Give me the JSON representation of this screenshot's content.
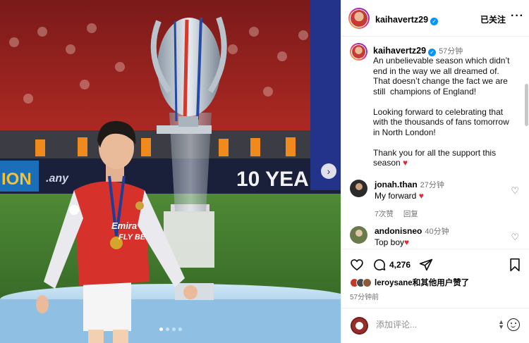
{
  "post": {
    "photo_alt": "Player walking past trophy on pitch",
    "carousel": {
      "total": 4,
      "active": 0
    },
    "stadium_board_text": "10 YEA"
  },
  "header": {
    "username": "kaihavertz29",
    "follow_state": "已关注",
    "more_label": "···"
  },
  "caption": {
    "username": "kaihavertz29",
    "time": "57分钟",
    "text": "An unbelievable season which didn’t end in the way we all dreamed of. That doesn’t change the fact we are still  champions of England!\n\nLooking forward to celebrating that with the thousands of fans tomorrow in North London!\n\nThank you for all the support this season ",
    "heart": "♥"
  },
  "comments": [
    {
      "username": "jonah.than",
      "time": "27分钟",
      "text": "My forward ",
      "heart": "♥",
      "likes": "7次赞",
      "reply": "回复",
      "avatar_color": "#2b2b2b"
    },
    {
      "username": "andonisneo",
      "time": "40分钟",
      "text": "Top boy",
      "heart": "♥",
      "avatar_color": "#6b7a4a"
    }
  ],
  "actions": {
    "comment_count": "4,276",
    "liked_by_user": "leroysane",
    "liked_by_suffix": "和其他用户赞了",
    "post_time": "57分钟前"
  },
  "add_comment": {
    "placeholder": "添加评论..."
  },
  "colors": {
    "accent_blue": "#0095f6",
    "heart_red": "#e0283b",
    "arsenal_red": "#d6322b"
  }
}
